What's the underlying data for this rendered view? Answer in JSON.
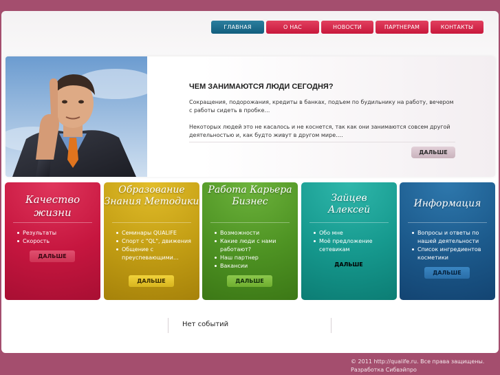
{
  "nav": {
    "items": [
      "ГЛАВНАЯ",
      "О НАС",
      "НОВОСТИ",
      "ПАРТНЕРАМ",
      "КОНТАКТЫ"
    ]
  },
  "hero": {
    "title": "ЧЕМ ЗАНИМАЮТСЯ ЛЮДИ СЕГОДНЯ?",
    "paragraph1": "Сокращения, подорожания, кредиты в банках, подъем по будильнику на работу, вечером с работы сидеть в пробке…",
    "paragraph2": "Некоторых людей это не касалось и не коснется, так как они занимаются совсем другой деятельностью и, как будто живут в другом мире….",
    "more_label": "ДАЛЬШЕ"
  },
  "cards": [
    {
      "title": "Качество жизни",
      "items": [
        "Результаты",
        "Скорость"
      ],
      "button": "ДАЛЬШЕ",
      "color": "#c6163f"
    },
    {
      "title": "Образование Знания Методики",
      "items": [
        "Семинары QUALIFE",
        "Спорт с \"QL\", движения",
        "Общение с преуспевающими…"
      ],
      "button": "ДАЛЬШЕ",
      "color": "#b58c0e"
    },
    {
      "title": "Работа Карьера Бизнес",
      "items": [
        "Возможности",
        "Какие люди с нами работают?",
        "Наш партнер",
        "Вакансии"
      ],
      "button": "ДАЛЬШЕ",
      "color": "#4a8c1f"
    },
    {
      "title": "Зайцев Алексей",
      "items": [
        "Обо мне",
        "Моё предложение сетевикам"
      ],
      "button": "ДАЛЬШЕ",
      "color": "#14948a"
    },
    {
      "title": "Информация",
      "items": [
        "Вопросы и ответы по нашей деятельности",
        "Список ингредиентов косметики"
      ],
      "button": "ДАЛЬШЕ",
      "color": "#1c5a8c"
    }
  ],
  "events": {
    "text": "Нет событий"
  },
  "footer": {
    "copyright": "© 2011 http://qualife.ru. Все права защищены.",
    "developer": "Разработка Сибвэйпро"
  }
}
